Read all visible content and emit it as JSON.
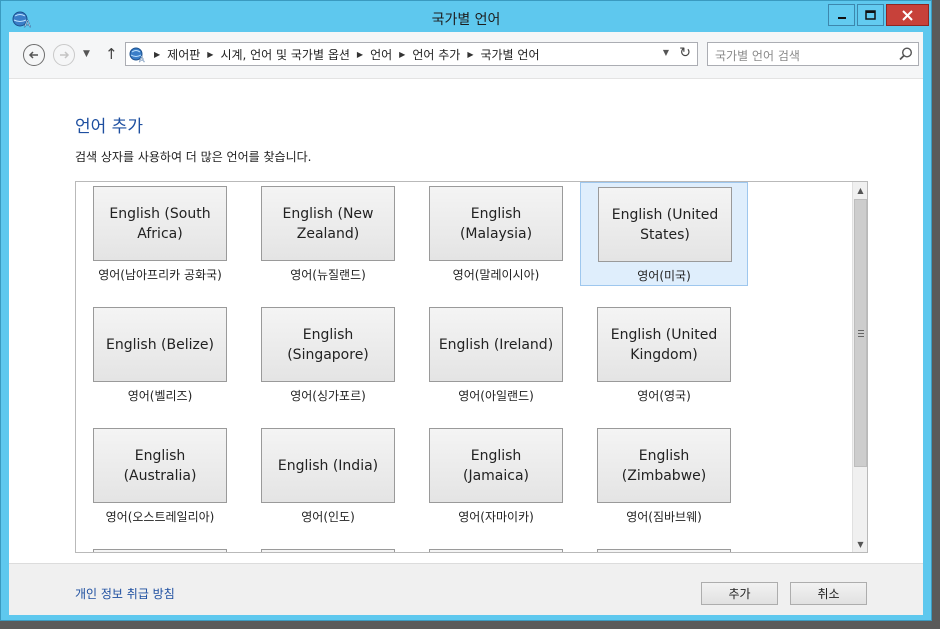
{
  "window": {
    "title": "국가별 언어"
  },
  "address": {
    "breadcrumbs": [
      "제어판",
      "시계, 언어 및 국가별 옵션",
      "언어",
      "언어 추가",
      "국가별 언어"
    ]
  },
  "search": {
    "placeholder": "국가별 언어 검색"
  },
  "main": {
    "title": "언어 추가",
    "description": "검색 상자를 사용하여 더 많은 언어를 찾습니다."
  },
  "languages": [
    {
      "name": "English (South Africa)",
      "label": "영어(남아프리카 공화국)",
      "selected": false
    },
    {
      "name": "English (New Zealand)",
      "label": "영어(뉴질랜드)",
      "selected": false
    },
    {
      "name": "English (Malaysia)",
      "label": "영어(말레이시아)",
      "selected": false
    },
    {
      "name": "English (United States)",
      "label": "영어(미국)",
      "selected": true
    },
    {
      "name": "English (Belize)",
      "label": "영어(벨리즈)",
      "selected": false
    },
    {
      "name": "English (Singapore)",
      "label": "영어(싱가포르)",
      "selected": false
    },
    {
      "name": "English (Ireland)",
      "label": "영어(아일랜드)",
      "selected": false
    },
    {
      "name": "English (United Kingdom)",
      "label": "영어(영국)",
      "selected": false
    },
    {
      "name": "English (Australia)",
      "label": "영어(오스트레일리아)",
      "selected": false
    },
    {
      "name": "English (India)",
      "label": "영어(인도)",
      "selected": false
    },
    {
      "name": "English (Jamaica)",
      "label": "영어(자마이카)",
      "selected": false
    },
    {
      "name": "English (Zimbabwe)",
      "label": "영어(짐바브웨)",
      "selected": false
    }
  ],
  "footer": {
    "privacy_link": "개인 정보 취급 방침",
    "add_label": "추가",
    "cancel_label": "취소"
  },
  "colors": {
    "title_bar": "#5ec8ee",
    "accent_text": "#1e4fa0",
    "selection": "#dfeefc",
    "close_button": "#c7413a"
  },
  "icons": [
    "app-globe-icon",
    "minimize-icon",
    "maximize-icon",
    "close-icon",
    "back-arrow-icon",
    "forward-arrow-icon",
    "dropdown-icon",
    "up-arrow-icon",
    "refresh-icon",
    "search-icon"
  ]
}
